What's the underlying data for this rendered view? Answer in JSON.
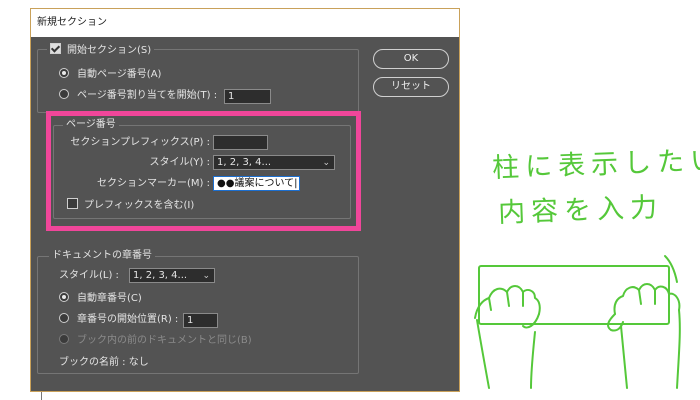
{
  "dialog": {
    "title": "新規セクション",
    "start_section": {
      "label": "開始セクション(S)",
      "checked": true
    },
    "auto_page_number": {
      "label": "自動ページ番号(A)",
      "selected": true
    },
    "start_page_number": {
      "label": "ページ番号割り当てを開始(T) :",
      "value": "1",
      "selected": false
    },
    "page_number_group": {
      "legend": "ページ番号",
      "section_prefix": {
        "label": "セクションプレフィックス(P) :",
        "value": ""
      },
      "style": {
        "label": "スタイル(Y) :",
        "value": "1, 2, 3, 4..."
      },
      "section_marker": {
        "label": "セクションマーカー(M) :",
        "value": "●●議案について"
      },
      "include_prefix": {
        "label": "プレフィックスを含む(I)",
        "checked": false
      }
    },
    "chapter_group": {
      "legend": "ドキュメントの章番号",
      "style": {
        "label": "スタイル(L) :",
        "value": "1, 2, 3, 4..."
      },
      "auto_chapter": {
        "label": "自動章番号(C)",
        "selected": true
      },
      "chapter_start": {
        "label": "章番号の開始位置(R) :",
        "value": "1",
        "selected": false
      },
      "same_as_previous": {
        "label": "ブック内の前のドキュメントと同じ(B)",
        "enabled": false
      },
      "book_name": "ブックの名前 : なし"
    },
    "ok_button": "OK",
    "reset_button": "リセット"
  },
  "annotation": {
    "line1": "柱に表示したい",
    "line2": "内容を入力",
    "highlight_color": "#f0469a",
    "pen_color": "#55c83a"
  }
}
